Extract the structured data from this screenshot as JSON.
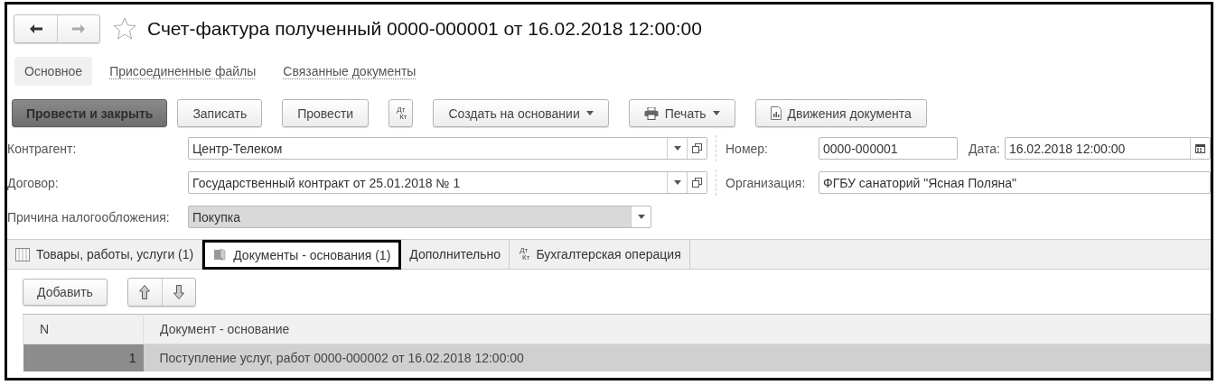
{
  "window": {
    "title": "Счет-фактура полученный 0000-000001 от 16.02.2018 12:00:00",
    "favorite": false
  },
  "sections": [
    {
      "label": "Основное",
      "selected": true
    },
    {
      "label": "Присоединенные файлы",
      "selected": false
    },
    {
      "label": "Связанные документы",
      "selected": false
    }
  ],
  "toolbar": [
    {
      "kind": "primary",
      "label": "Провести и закрыть"
    },
    {
      "kind": "plain",
      "label": "Записать"
    },
    {
      "kind": "plain",
      "label": "Провести"
    },
    {
      "kind": "dtkt",
      "icon_text": [
        "Дт",
        "Кт"
      ]
    },
    {
      "kind": "menu",
      "label": "Создать на основании"
    },
    {
      "kind": "print",
      "label": "Печать"
    },
    {
      "kind": "report",
      "label": "Движения документа"
    }
  ],
  "form_rows": [
    {
      "fields": [
        {
          "kind": "reference",
          "label": "Контрагент:",
          "value": "Центр-Телеком",
          "disabled": false
        },
        {
          "kind": "text",
          "label": "Номер:",
          "value": "0000-000001",
          "disabled": false
        },
        {
          "kind": "date",
          "label": "Дата:",
          "value": "16.02.2018 12:00:00",
          "disabled": false
        }
      ]
    },
    {
      "fields": [
        {
          "kind": "reference",
          "label": "Договор:",
          "value": "Государственный контракт от 25.01.2018 № 1",
          "disabled": false
        },
        {
          "kind": "text",
          "label": "Организация:",
          "value": "ФГБУ санаторий \"Ясная Поляна\"",
          "disabled": false
        }
      ]
    },
    {
      "fields": [
        {
          "kind": "select",
          "label": "Причина налогообложения:",
          "value": "Покупка",
          "disabled": true
        }
      ]
    }
  ],
  "tabs": [
    {
      "kind": "table",
      "label": "Товары, работы, услуги (1)",
      "selected": false
    },
    {
      "kind": "document",
      "label": "Документы - основания (1)",
      "selected": true
    },
    {
      "kind": "plain",
      "label": "Дополнительно",
      "selected": false
    },
    {
      "kind": "dtkt",
      "icon_text": [
        "Дт",
        "Кт"
      ],
      "label": "Бухгалтерская операция",
      "selected": false
    }
  ],
  "table_toolbar": {
    "add": "Добавить"
  },
  "table": {
    "columns": [
      "N",
      "Документ - основание"
    ],
    "rows": [
      {
        "cells": [
          "1",
          "Поступление услуг, работ 0000-000002 от 16.02.2018 12:00:00"
        ],
        "selected": true
      }
    ]
  }
}
